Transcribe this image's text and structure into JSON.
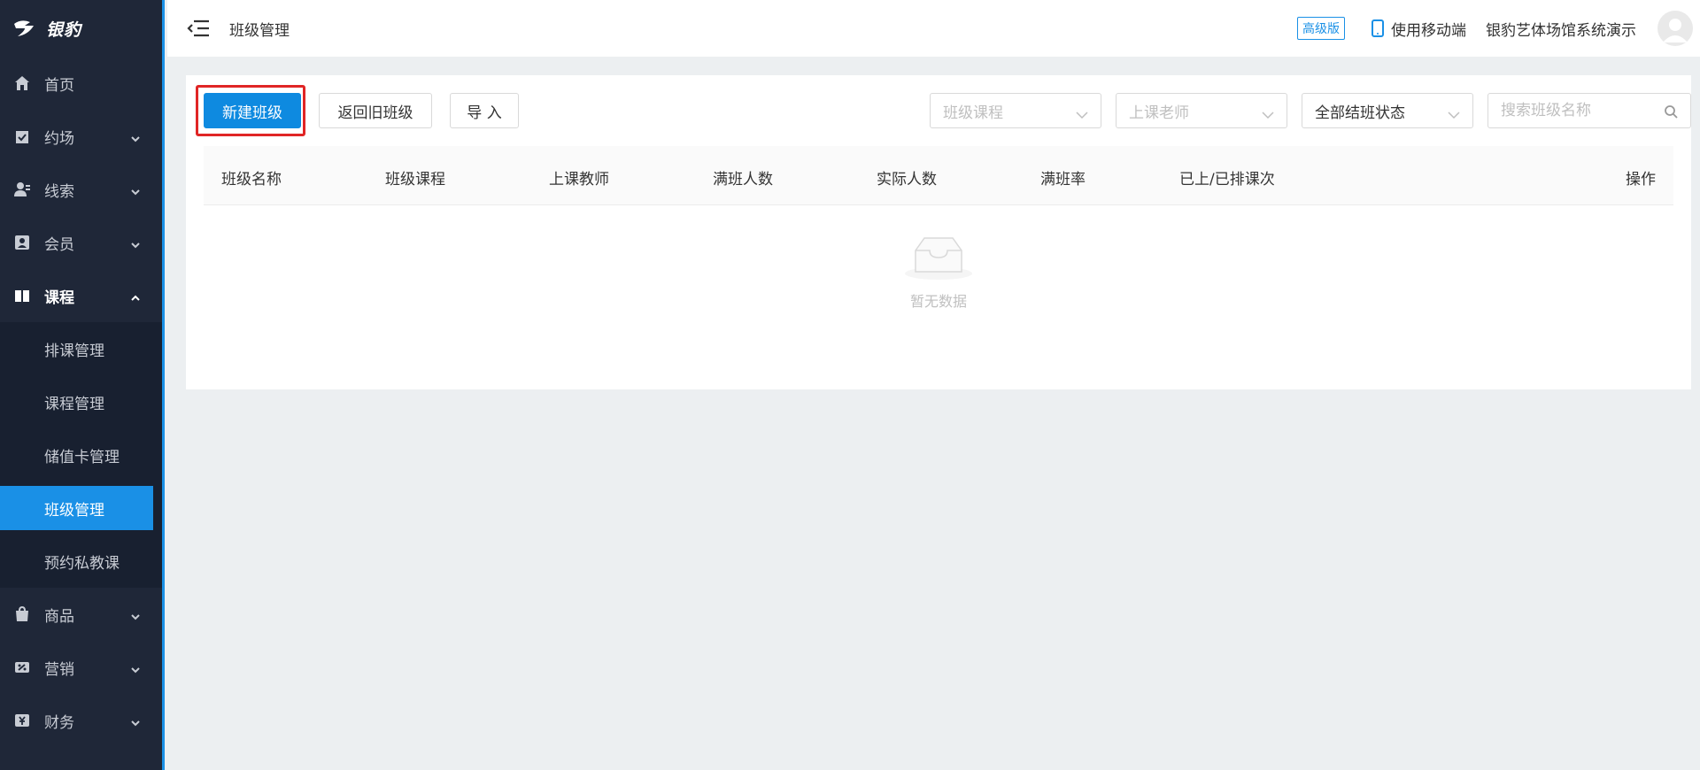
{
  "brand": {
    "name": "银豹"
  },
  "sidebar": {
    "items": [
      {
        "label": "首页",
        "icon": "home-icon",
        "expandable": false
      },
      {
        "label": "约场",
        "icon": "calendar-check-icon",
        "expandable": true
      },
      {
        "label": "线索",
        "icon": "user-lead-icon",
        "expandable": true
      },
      {
        "label": "会员",
        "icon": "member-card-icon",
        "expandable": true
      },
      {
        "label": "课程",
        "icon": "book-icon",
        "expandable": true,
        "open": true
      },
      {
        "label": "商品",
        "icon": "shopping-bag-icon",
        "expandable": true
      },
      {
        "label": "营销",
        "icon": "coupon-icon",
        "expandable": true
      },
      {
        "label": "财务",
        "icon": "finance-icon",
        "expandable": true
      }
    ],
    "course_submenu": [
      {
        "label": "排课管理"
      },
      {
        "label": "课程管理"
      },
      {
        "label": "储值卡管理"
      },
      {
        "label": "班级管理",
        "active": true
      },
      {
        "label": "预约私教课"
      }
    ]
  },
  "header": {
    "title": "班级管理",
    "edition_badge": "高级版",
    "mobile_label": "使用移动端",
    "venue_name": "银豹艺体场馆系统演示"
  },
  "toolbar": {
    "new_class": "新建班级",
    "back_old": "返回旧班级",
    "import": "导 入",
    "course_select_placeholder": "班级课程",
    "teacher_select_placeholder": "上课老师",
    "status_select_value": "全部结班状态",
    "search_placeholder": "搜索班级名称"
  },
  "table": {
    "columns": [
      "班级名称",
      "班级课程",
      "上课教师",
      "满班人数",
      "实际人数",
      "满班率",
      "已上/已排课次",
      "操作"
    ],
    "rows": [],
    "empty_text": "暂无数据"
  },
  "colors": {
    "accent": "#1a90e6",
    "primary_button": "#0e8ae0",
    "sidebar_bg": "#1f2738",
    "highlight_border": "#e02525"
  }
}
